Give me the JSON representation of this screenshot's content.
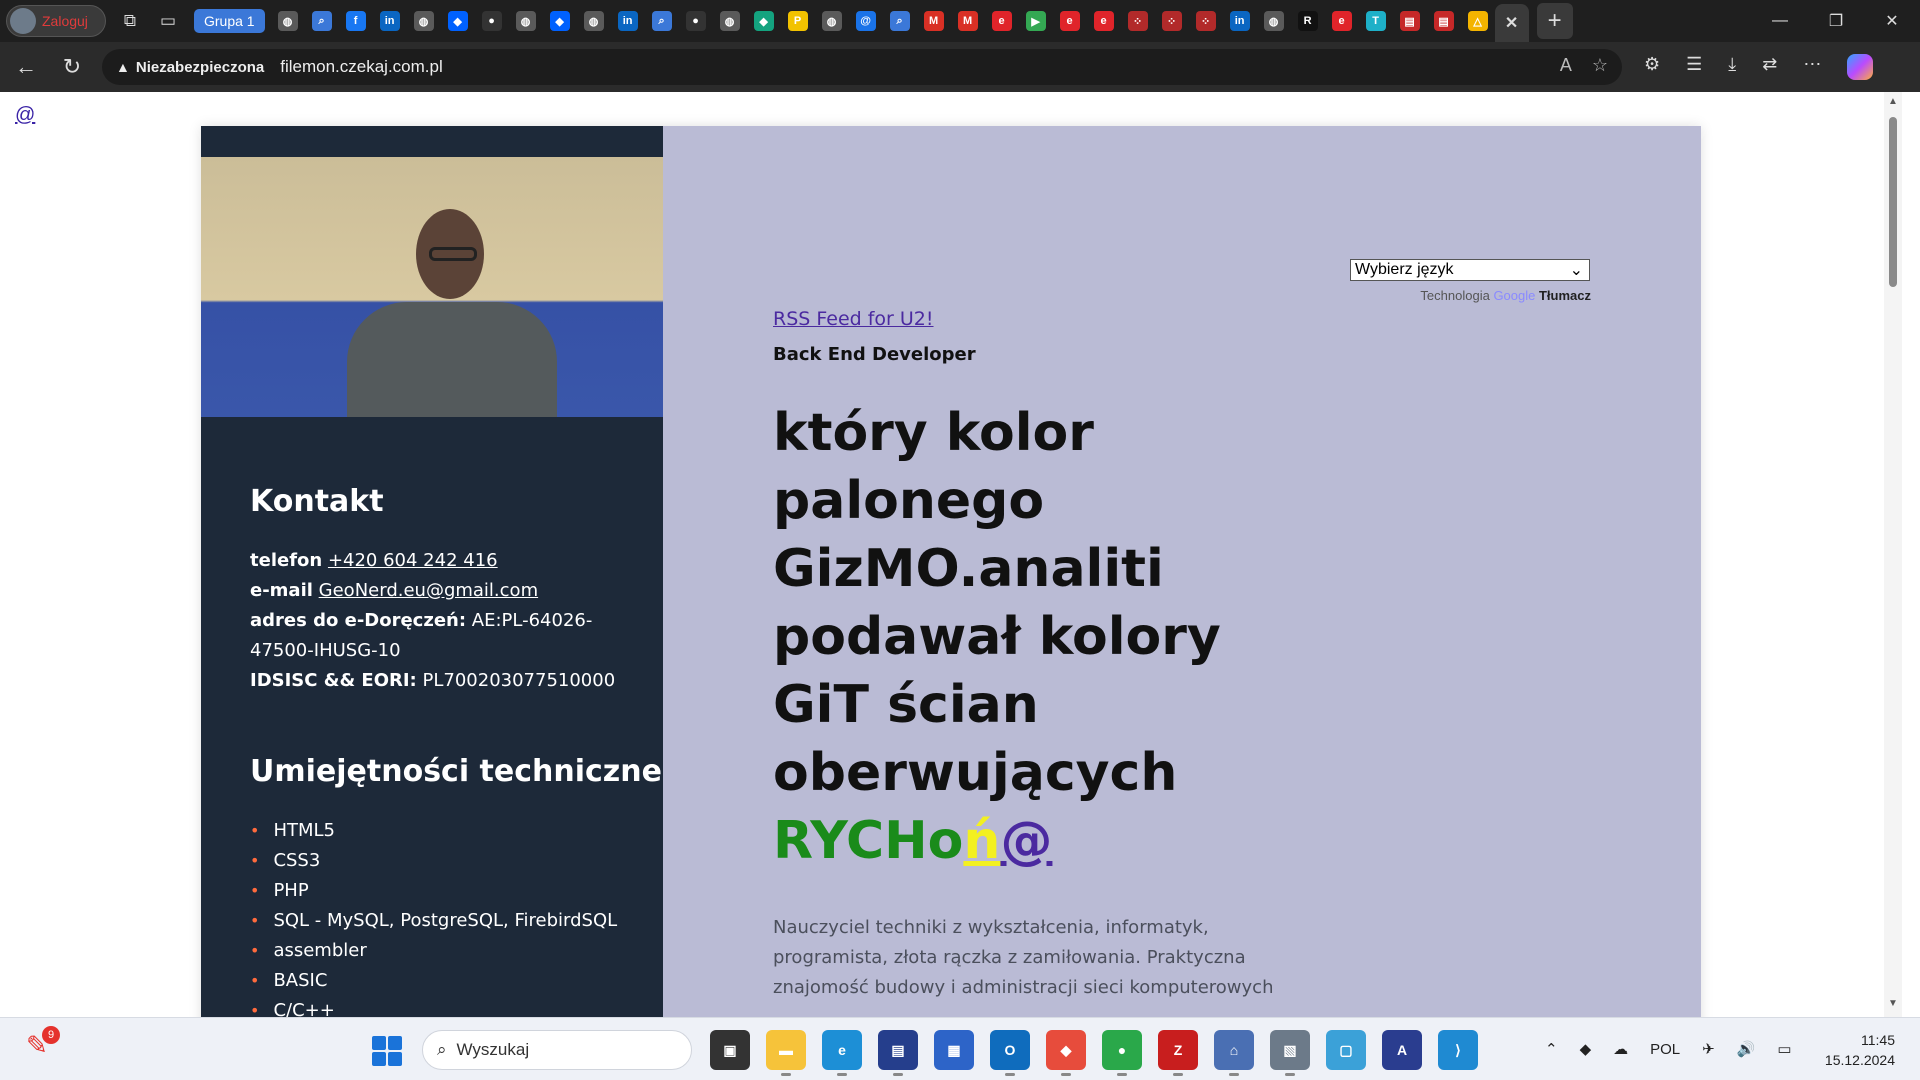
{
  "browser": {
    "profile_label": "Zaloguj",
    "tab_group_label": "Grupa 1",
    "tabs": [
      {
        "icon": "globe-icon",
        "color": "#5a5a5a"
      },
      {
        "icon": "search-icon",
        "color": "#3b78d8"
      },
      {
        "icon": "facebook-icon",
        "color": "#1877f2"
      },
      {
        "icon": "linkedin-icon",
        "color": "#0a66c2"
      },
      {
        "icon": "globe-icon",
        "color": "#5a5a5a"
      },
      {
        "icon": "dropbox-icon",
        "color": "#0061fe"
      },
      {
        "icon": "github-icon",
        "color": "#333333"
      },
      {
        "icon": "globe-icon",
        "color": "#5a5a5a"
      },
      {
        "icon": "dropbox-icon",
        "color": "#0061fe"
      },
      {
        "icon": "globe-icon",
        "color": "#5a5a5a"
      },
      {
        "icon": "linkedin-icon",
        "color": "#0a66c2"
      },
      {
        "icon": "search-icon",
        "color": "#3b78d8"
      },
      {
        "icon": "github-icon",
        "color": "#333333"
      },
      {
        "icon": "globe-icon",
        "color": "#5a5a5a"
      },
      {
        "icon": "diamond-icon",
        "color": "#14a37f"
      },
      {
        "icon": "p-icon",
        "color": "#f2c200"
      },
      {
        "icon": "globe-icon",
        "color": "#5a5a5a"
      },
      {
        "icon": "at-icon",
        "color": "#1a73e8"
      },
      {
        "icon": "search-icon",
        "color": "#3b78d8"
      },
      {
        "icon": "gmail-icon",
        "color": "#d93025"
      },
      {
        "icon": "gmail-icon",
        "color": "#d93025"
      },
      {
        "icon": "e-icon",
        "color": "#e0242a"
      },
      {
        "icon": "play-icon",
        "color": "#34a853"
      },
      {
        "icon": "e-icon",
        "color": "#e0242a"
      },
      {
        "icon": "e-icon",
        "color": "#e0242a"
      },
      {
        "icon": "dots-icon",
        "color": "#b22a2a"
      },
      {
        "icon": "dots-icon",
        "color": "#b22a2a"
      },
      {
        "icon": "dots-icon",
        "color": "#b22a2a"
      },
      {
        "icon": "linkedin-icon",
        "color": "#0a66c2"
      },
      {
        "icon": "globe-icon",
        "color": "#5a5a5a"
      },
      {
        "icon": "r-icon",
        "color": "#111111"
      },
      {
        "icon": "e-icon",
        "color": "#e0242a"
      },
      {
        "icon": "tp-icon",
        "color": "#1eb0c8"
      },
      {
        "icon": "pdf-icon",
        "color": "#c62828"
      },
      {
        "icon": "pdf-icon",
        "color": "#c62828"
      },
      {
        "icon": "drive-icon",
        "color": "#f4b400"
      }
    ],
    "url_warning": "Niezabezpieczona",
    "url_host": "filemon.czekaj.com.pl"
  },
  "page": {
    "top_link": "@",
    "sidebar": {
      "contact_title": "Kontakt",
      "phone_label": "telefon",
      "phone_value": "+420 604 242 416",
      "email_label": "e-mail",
      "email_value": "GeoNerd.eu@gmail.com",
      "edelivery_label": "adres do e-Doręczeń:",
      "edelivery_value": "AE:PL-64026-47500-IHUSG-10",
      "ids_label": "IDSISC && EORI:",
      "ids_value": "PL700203077510000",
      "skills_title": "Umiejętności techniczne",
      "skills": [
        "HTML5",
        "CSS3",
        "PHP",
        "SQL - MySQL, PostgreSQL, FirebirdSQL",
        "assembler",
        "BASIC",
        "C/C++"
      ]
    },
    "main": {
      "language_select": "Wybierz język",
      "powered_prefix": "Technologia",
      "powered_brand": "Google",
      "powered_suffix": "Tłumacz",
      "rss_link": "RSS Feed for U2!",
      "role": "Back End Developer",
      "headline_lines": [
        "który kolor",
        "palonego",
        "GizMO.analiti",
        "podawał kolory",
        "GiT ścian",
        "oberwujących"
      ],
      "headline_green": "RYCHo",
      "headline_yellow": "ń",
      "headline_at": "@",
      "bio": "Nauczyciel techniki z wykształcenia, informatyk, programista, złota rączka z zamiłowania. Praktyczna znajomość budowy i administracji sieci komputerowych"
    }
  },
  "taskbar": {
    "notification_count": "9",
    "search_placeholder": "Wyszukaj",
    "language": "POL",
    "time": "11:45",
    "date": "15.12.2024"
  }
}
